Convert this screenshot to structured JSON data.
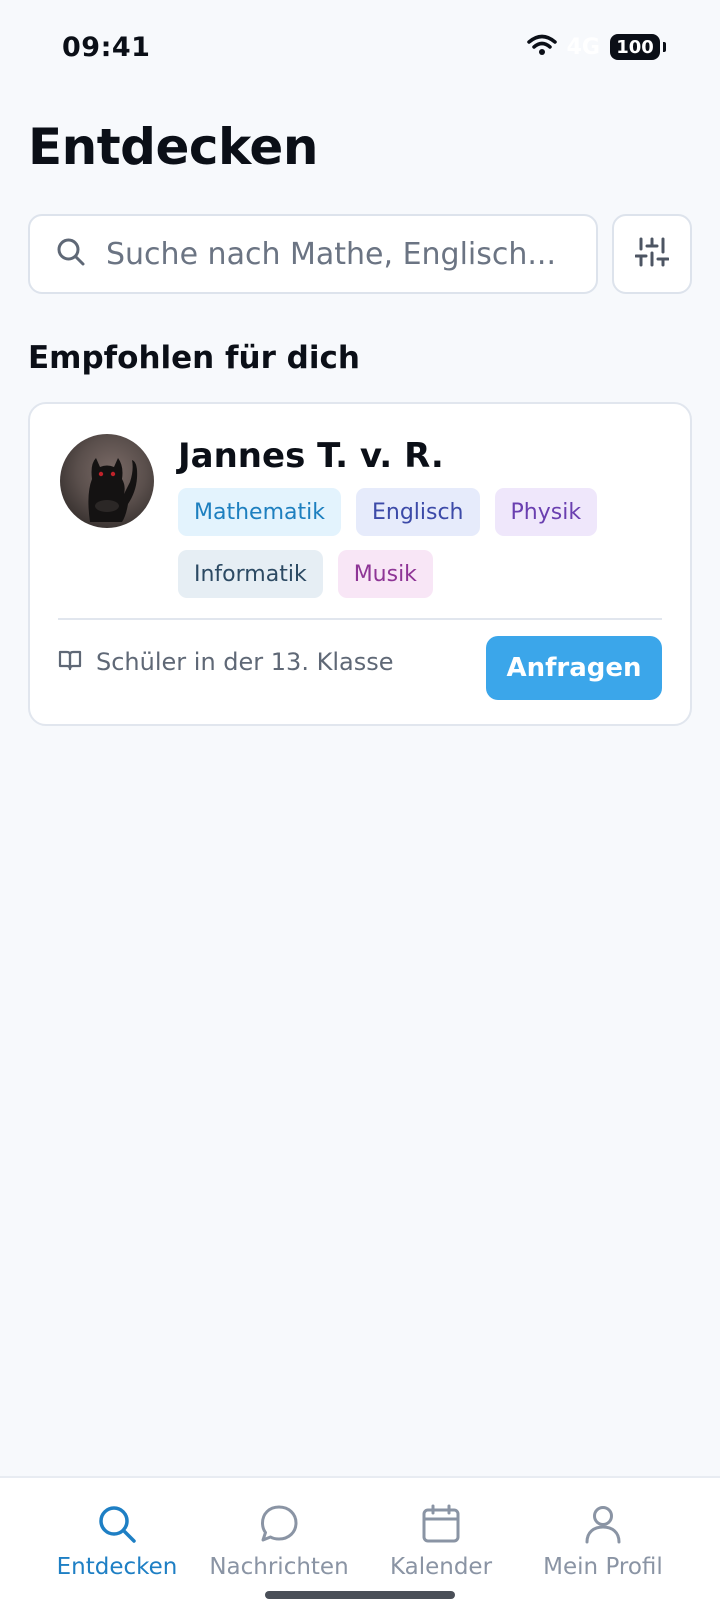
{
  "status": {
    "time": "09:41",
    "network": "4G",
    "battery": "100"
  },
  "header": {
    "title": "Entdecken"
  },
  "search": {
    "placeholder": "Suche nach Mathe, Englisch..."
  },
  "section": {
    "title": "Empfohlen für dich"
  },
  "tutor": {
    "name": "Jannes T. v. R.",
    "subjects": [
      {
        "label": "Mathematik",
        "bg": "#e3f3fd",
        "fg": "#1d7fbf"
      },
      {
        "label": "Englisch",
        "bg": "#e6ebfb",
        "fg": "#3c4aa8"
      },
      {
        "label": "Physik",
        "bg": "#efe7fb",
        "fg": "#6a3fb0"
      },
      {
        "label": "Informatik",
        "bg": "#e6eef4",
        "fg": "#2c4a63"
      },
      {
        "label": "Musik",
        "bg": "#f8e6f6",
        "fg": "#8e3596"
      }
    ],
    "grade": "Schüler in der 13. Klasse",
    "request_label": "Anfragen"
  },
  "tabs": [
    {
      "label": "Entdecken",
      "icon": "search-icon",
      "active": true
    },
    {
      "label": "Nachrichten",
      "icon": "chat-icon",
      "active": false
    },
    {
      "label": "Kalender",
      "icon": "calendar-icon",
      "active": false
    },
    {
      "label": "Mein Profil",
      "icon": "person-icon",
      "active": false
    }
  ],
  "colors": {
    "accent": "#3ba6ea",
    "active_tab": "#1e7fc4",
    "inactive_tab": "#8a94a4",
    "background": "#f7f9fc"
  }
}
